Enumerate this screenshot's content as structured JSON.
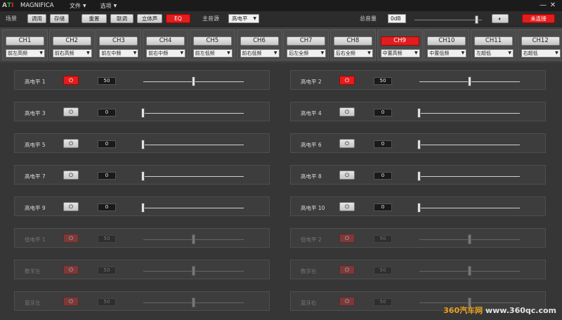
{
  "app": {
    "title": "MAGNIFICA",
    "logo": "ATI"
  },
  "menu": [
    {
      "label": "文件"
    },
    {
      "label": "选项"
    }
  ],
  "window": {
    "minimize": "—",
    "close": "✕"
  },
  "toolbar": {
    "scene_label": "场景",
    "recall": "调用",
    "save": "存储",
    "reset": "重置",
    "link": "联调",
    "stereo": "立体声",
    "eq": "EQ",
    "main_source_label": "主音源",
    "main_source_value": "高电平",
    "master_volume_label": "总音量",
    "master_volume_value": "0dB",
    "speaker_icon": "speaker-icon",
    "connect_status": "未连接",
    "colors": {
      "accent": "#e21d1d"
    }
  },
  "channels": [
    {
      "name": "CH1",
      "assign": "前左高频",
      "active": false
    },
    {
      "name": "CH2",
      "assign": "前右高频",
      "active": false
    },
    {
      "name": "CH3",
      "assign": "前左中频",
      "active": false
    },
    {
      "name": "CH4",
      "assign": "前右中频",
      "active": false
    },
    {
      "name": "CH5",
      "assign": "前左低频",
      "active": false
    },
    {
      "name": "CH6",
      "assign": "前右低频",
      "active": false
    },
    {
      "name": "CH7",
      "assign": "后左全频",
      "active": false
    },
    {
      "name": "CH8",
      "assign": "后右全频",
      "active": false
    },
    {
      "name": "CH9",
      "assign": "中置高频",
      "active": true
    },
    {
      "name": "CH10",
      "assign": "中置低频",
      "active": false
    },
    {
      "name": "CH11",
      "assign": "左超低",
      "active": false
    },
    {
      "name": "CH12",
      "assign": "右超低",
      "active": false
    }
  ],
  "inputs": [
    {
      "label": "高电平 1",
      "value": "50",
      "on": true,
      "level": 0.5,
      "enabled": true
    },
    {
      "label": "高电平 2",
      "value": "50",
      "on": true,
      "level": 0.5,
      "enabled": true
    },
    {
      "label": "高电平 3",
      "value": "0",
      "on": false,
      "level": 0,
      "enabled": true
    },
    {
      "label": "高电平 4",
      "value": "0",
      "on": false,
      "level": 0,
      "enabled": true
    },
    {
      "label": "高电平 5",
      "value": "0",
      "on": false,
      "level": 0,
      "enabled": true
    },
    {
      "label": "高电平 6",
      "value": "0",
      "on": false,
      "level": 0,
      "enabled": true
    },
    {
      "label": "高电平 7",
      "value": "0",
      "on": false,
      "level": 0,
      "enabled": true
    },
    {
      "label": "高电平 8",
      "value": "0",
      "on": false,
      "level": 0,
      "enabled": true
    },
    {
      "label": "高电平 9",
      "value": "0",
      "on": false,
      "level": 0,
      "enabled": true
    },
    {
      "label": "高电平 10",
      "value": "0",
      "on": false,
      "level": 0,
      "enabled": true
    },
    {
      "label": "低电平 1",
      "value": "50",
      "on": true,
      "level": 0.5,
      "enabled": false
    },
    {
      "label": "低电平 2",
      "value": "50",
      "on": true,
      "level": 0.5,
      "enabled": false
    },
    {
      "label": "数字左",
      "value": "50",
      "on": true,
      "level": 0.5,
      "enabled": false
    },
    {
      "label": "数字右",
      "value": "50",
      "on": true,
      "level": 0.5,
      "enabled": false
    },
    {
      "label": "蓝牙左",
      "value": "50",
      "on": true,
      "level": 0.5,
      "enabled": false
    },
    {
      "label": "蓝牙右",
      "value": "50",
      "on": true,
      "level": 0.5,
      "enabled": false
    }
  ],
  "icons": {
    "power": "power-icon",
    "dropdown": "chevron-down-icon"
  },
  "watermark": {
    "brand": "360汽车网",
    "url": "www.360qc.com"
  }
}
